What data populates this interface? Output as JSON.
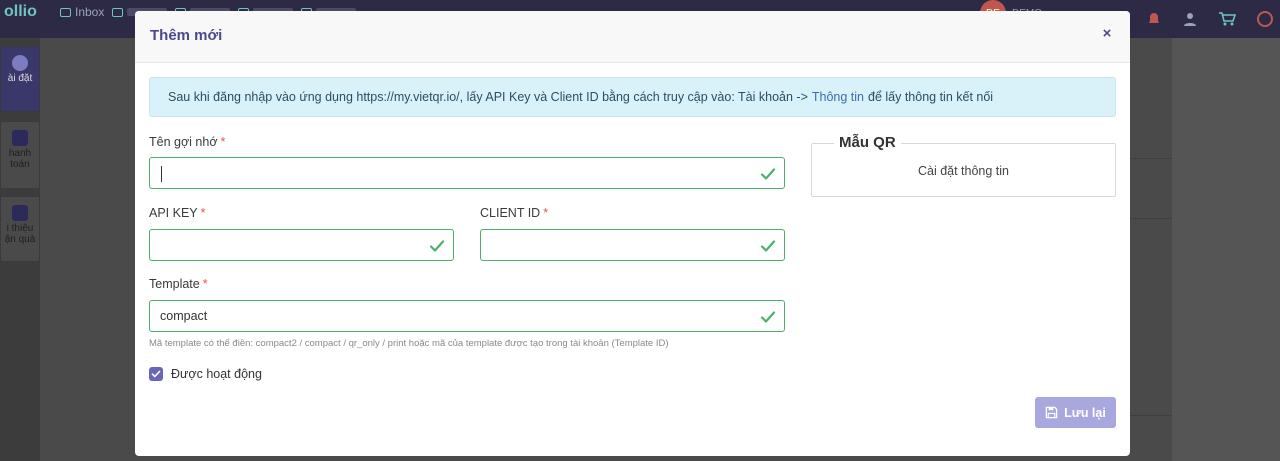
{
  "app": {
    "logo": "ollio",
    "topnav": [
      {
        "label": "Inbox"
      },
      {
        "label": ""
      },
      {
        "label": ""
      },
      {
        "label": ""
      },
      {
        "label": ""
      },
      {
        "label": ""
      }
    ],
    "demo_label": "DEMO",
    "demo_avatar": "DE"
  },
  "sidebar": {
    "items": [
      {
        "label": "ài đặt",
        "icon": "gear-icon",
        "active": true
      },
      {
        "label": "hanh toán",
        "icon": "card-icon",
        "active": false
      },
      {
        "label": "i thiệu ận quà",
        "icon": "user-add-icon",
        "active": false
      }
    ]
  },
  "modal": {
    "title": "Thêm mới",
    "close_label": "×",
    "alert": {
      "before": "Sau khi đăng nhập vào ứng dụng https://my.vietqr.io/, lấy API Key và Client ID bằng cách truy cập vào: Tài khoản ->",
      "link": "Thông tin",
      "after": "để lấy thông tin kết nối"
    },
    "fields": {
      "name": {
        "label": "Tên gợi nhớ",
        "value": ""
      },
      "api_key": {
        "label": "API KEY",
        "value": ""
      },
      "client_id": {
        "label": "CLIENT ID",
        "value": ""
      },
      "template": {
        "label": "Template",
        "value": "compact"
      }
    },
    "required_mark": "*",
    "hint": "Mã template có thể điền: compact2 / compact / qr_only / print hoặc mã của template được tạo trong tài khoản (Template ID)",
    "active_checkbox": {
      "label": "Được hoạt động",
      "checked": true
    },
    "qr": {
      "legend": "Mẫu QR",
      "text": "Cài đặt thông tin"
    },
    "save_label": "Lưu lại"
  },
  "colors": {
    "accent": "#4b4a8f",
    "valid_border": "#4caf6a",
    "alert_bg": "#d9f1f8",
    "button": "#a8a7de",
    "required": "#e55353"
  }
}
